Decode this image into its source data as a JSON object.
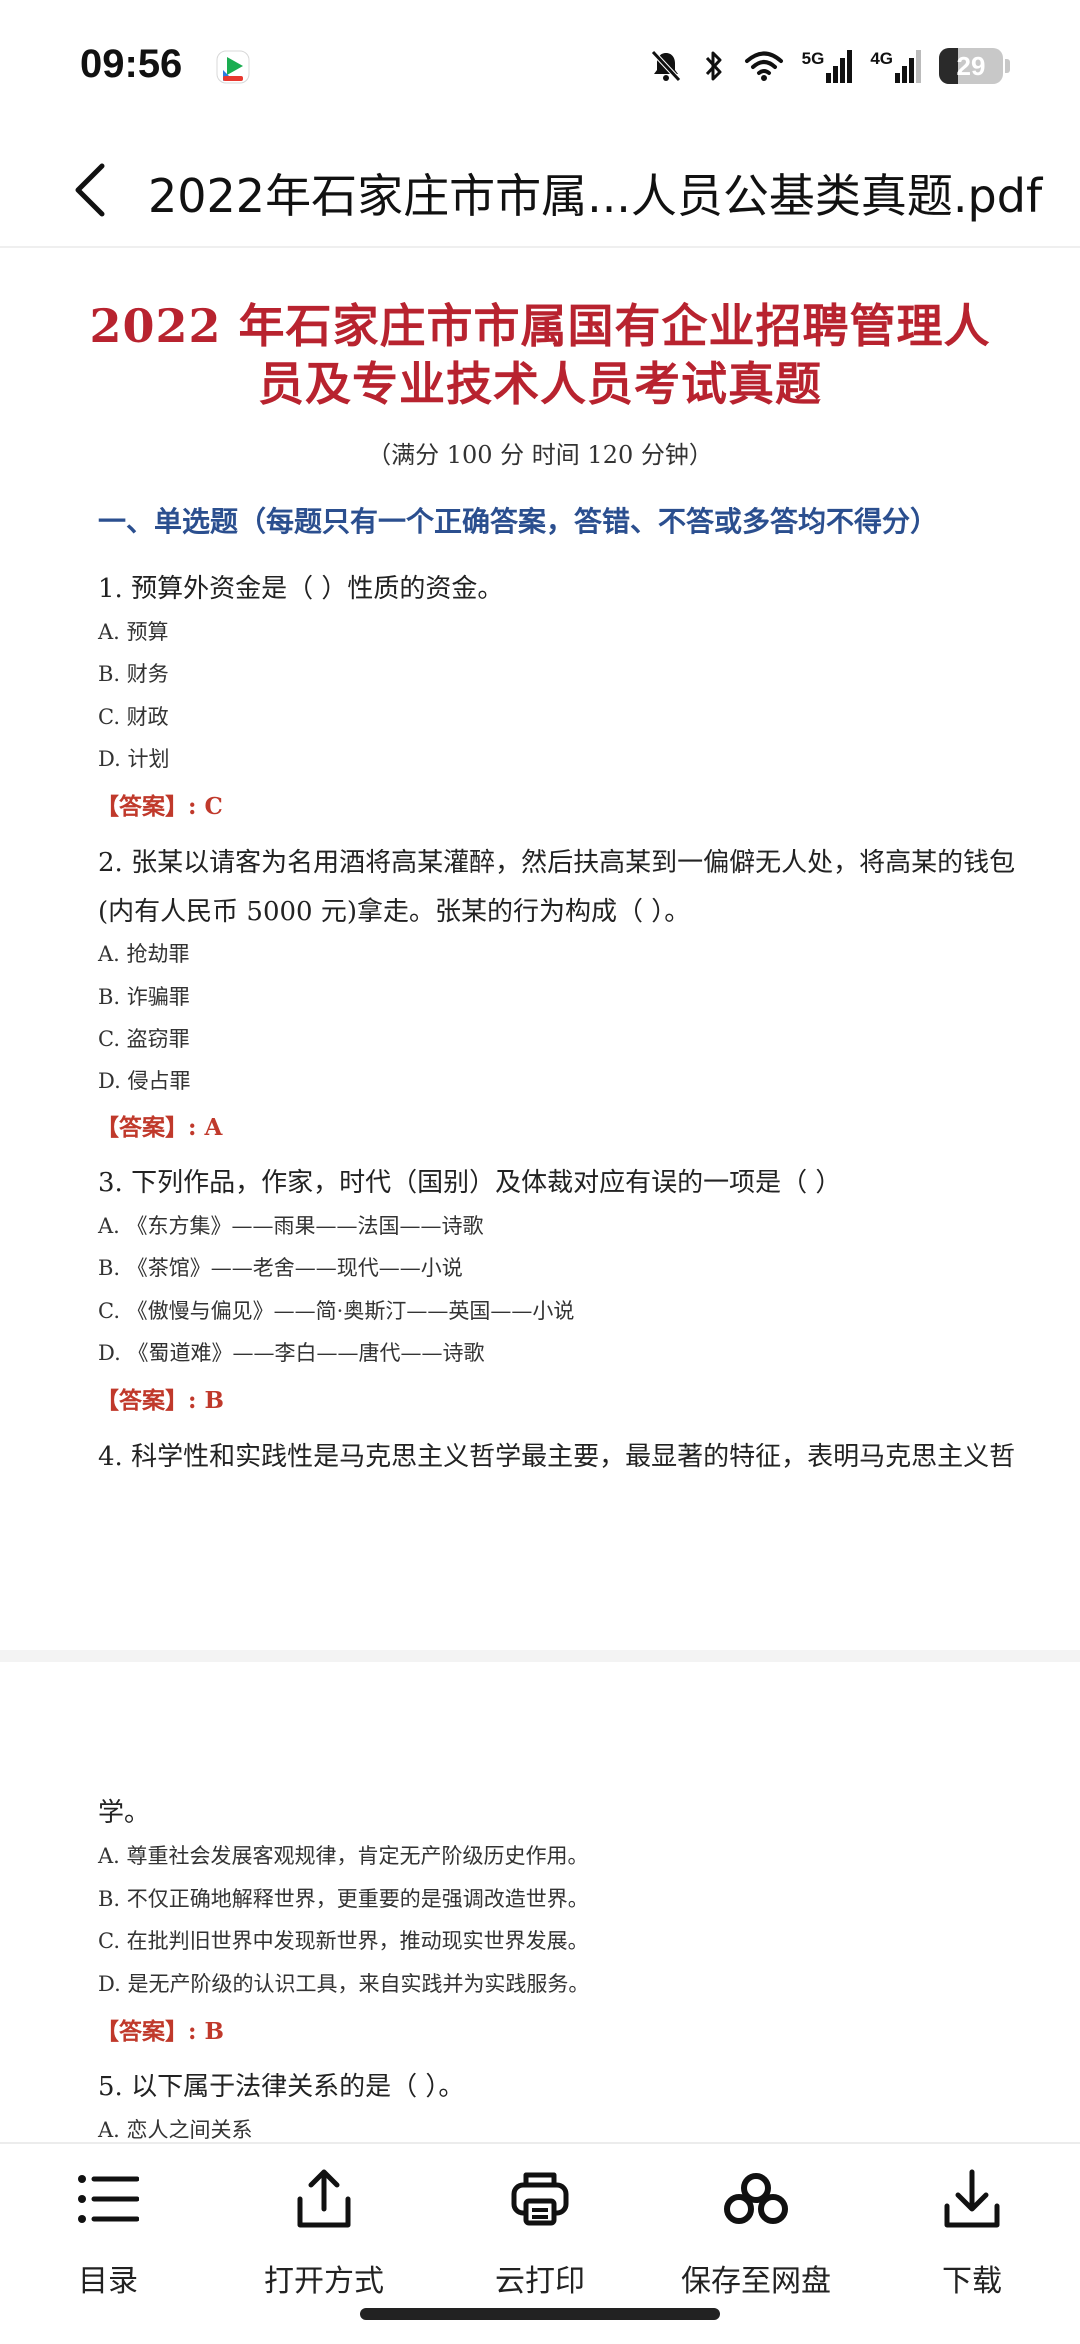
{
  "status_bar": {
    "time": "09:56",
    "net1": "5G",
    "net2": "4G",
    "battery": "29",
    "battery_level": 0.29
  },
  "header": {
    "title": "2022年石家庄市市属...人员公基类真题.pdf"
  },
  "document": {
    "title_line1": "2022 年石家庄市市属国有企业招聘管理人",
    "title_line2": "员及专业技术人员考试真题",
    "subtitle": "（满分 100 分     时间 120 分钟）",
    "section": "一、单选题（每题只有一个正确答案，答错、不答或多答均不得分）",
    "q1": {
      "text": "1. 预算外资金是（  ）性质的资金。",
      "a": "A. 预算",
      "b": "B. 财务",
      "c": "C. 财政",
      "d": "D. 计划",
      "answer": "【答案】: C"
    },
    "q2": {
      "line1": "2. 张某以请客为名用酒将高某灌醉，然后扶高某到一偏僻无人处，将高某的钱包",
      "line2": "(内有人民币 5000 元)拿走。张某的行为构成（  ）。",
      "a": "A. 抢劫罪",
      "b": "B. 诈骗罪",
      "c": "C. 盗窃罪",
      "d": "D. 侵占罪",
      "answer": "【答案】: A"
    },
    "q3": {
      "text": "3. 下列作品，作家，时代（国别）及体裁对应有误的一项是（  ）",
      "a": "A. 《东方集》——雨果——法国——诗歌",
      "b": "B. 《茶馆》——老舍——现代——小说",
      "c": "C. 《傲慢与偏见》——简·奥斯汀——英国——小说",
      "d": "D. 《蜀道难》——李白——唐代——诗歌",
      "answer": "【答案】: B"
    },
    "q4": {
      "line1": "4. 科学性和实践性是马克思主义哲学最主要，最显著的特征，表明马克思主义哲",
      "line2": "学。",
      "a": "A. 尊重社会发展客观规律，肯定无产阶级历史作用。",
      "b": "B. 不仅正确地解释世界，更重要的是强调改造世界。",
      "c": "C. 在批判旧世界中发现新世界，推动现实世界发展。",
      "d": "D. 是无产阶级的认识工具，来自实践并为实践服务。",
      "answer": "【答案】: B"
    },
    "q5": {
      "text": "5. 以下属于法律关系的是（  ）。",
      "a": "A. 恋人之间关系"
    }
  },
  "toolbar": {
    "catalog": "目录",
    "open_with": "打开方式",
    "cloud_print": "云打印",
    "save_to_disk": "保存至网盘",
    "download": "下载"
  }
}
